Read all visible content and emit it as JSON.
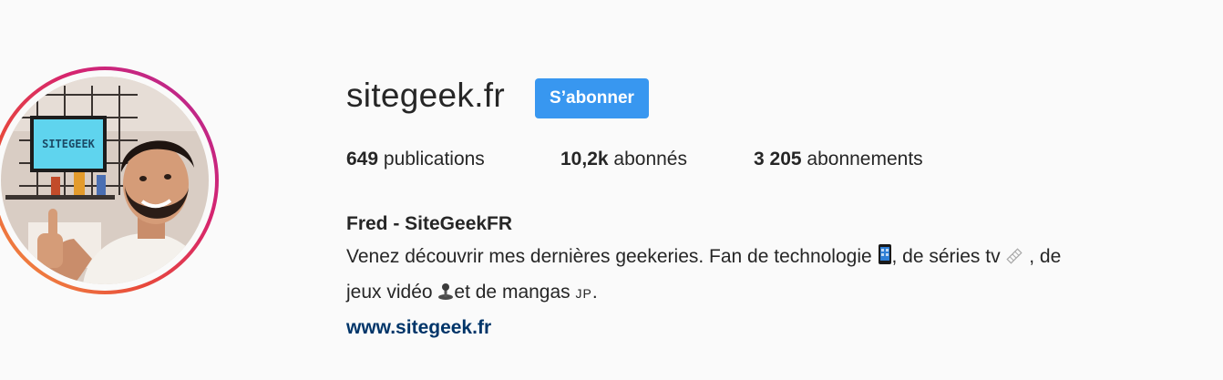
{
  "profile": {
    "username": "sitegeek.fr",
    "follow_label": "S’abonner",
    "avatar_sign_text": "SITEGEEK"
  },
  "stats": {
    "posts_count": "649",
    "posts_label": "publications",
    "followers_count": "10,2k",
    "followers_label": "abonnés",
    "following_count": "3 205",
    "following_label": "abonnements"
  },
  "bio": {
    "full_name": "Fred - SiteGeekFR",
    "line1_a": "Venez découvrir mes dernières geekeries. Fan de technologie ",
    "line1_b": ", de séries tv ",
    "line1_c": " , de",
    "line2_a": "jeux vidéo ",
    "line2_b": "et de mangas ",
    "line2_jp": "JP",
    "line2_end": ".",
    "website": "www.sitegeek.fr"
  },
  "icons": {
    "phone": "mobile-phone-icon",
    "tv": "film-strip-icon",
    "game": "joystick-icon"
  },
  "colors": {
    "follow_button": "#3897f0",
    "link": "#003569",
    "background": "#fafafa",
    "story_ring_start": "#b12a9a",
    "story_ring_end": "#f4a043"
  }
}
